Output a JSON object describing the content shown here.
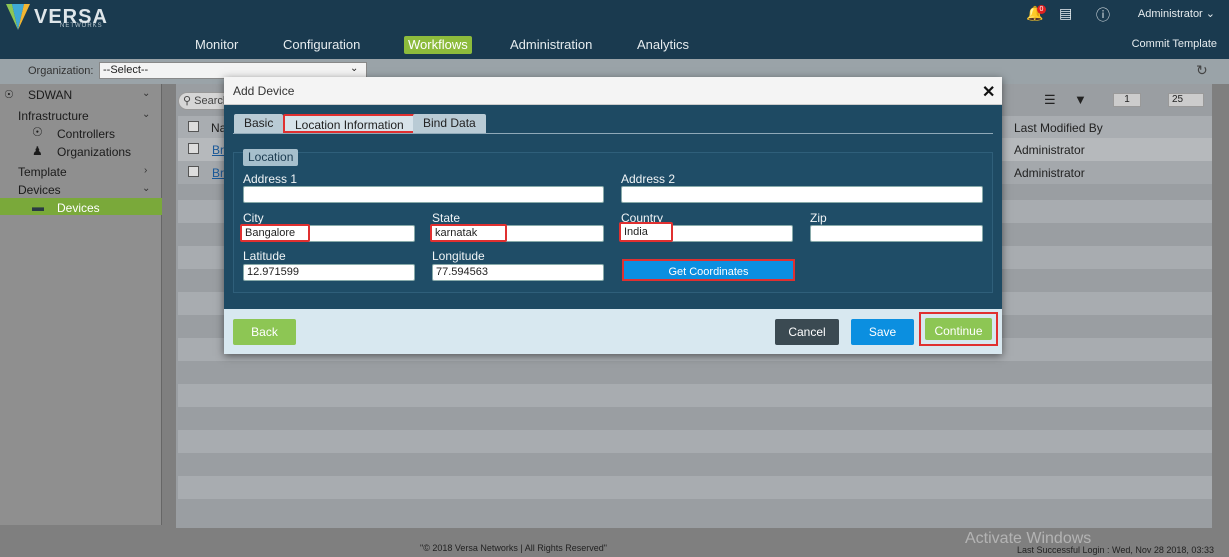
{
  "app": {
    "logo": "VERSA",
    "logo_sub": "NETWORKS",
    "notification_count": "0",
    "user": "Administrator",
    "commit": "Commit Template"
  },
  "nav": [
    "Monitor",
    "Configuration",
    "Workflows",
    "Administration",
    "Analytics"
  ],
  "org": {
    "label": "Organization:",
    "value": "--Select--"
  },
  "sidebar": {
    "sdwan": "SDWAN",
    "infrastructure": "Infrastructure",
    "controllers": "Controllers",
    "organizations": "Organizations",
    "template": "Template",
    "devices": "Devices",
    "devices_item": "Devices"
  },
  "grid": {
    "search_placeholder": "Search",
    "col_name": "Na",
    "col_last_modified": "Last Modified By",
    "rows": [
      {
        "name": "Br",
        "last_modified_by": "Administrator"
      },
      {
        "name": "Br",
        "last_modified_by": "Administrator"
      }
    ],
    "page": "1",
    "page_size": "25"
  },
  "dialog": {
    "title": "Add Device",
    "tabs": [
      "Basic",
      "Location Information",
      "Bind Data"
    ],
    "section": "Location",
    "fields": {
      "address1": {
        "label": "Address 1",
        "value": ""
      },
      "address2": {
        "label": "Address 2",
        "value": ""
      },
      "city": {
        "label": "City",
        "value": "Bangalore"
      },
      "state": {
        "label": "State",
        "value": "karnatak"
      },
      "country": {
        "label": "Country",
        "value": "India"
      },
      "zip": {
        "label": "Zip",
        "value": ""
      },
      "latitude": {
        "label": "Latitude",
        "value": "12.971599"
      },
      "longitude": {
        "label": "Longitude",
        "value": "77.594563"
      }
    },
    "get_coordinates": "Get Coordinates",
    "buttons": {
      "back": "Back",
      "cancel": "Cancel",
      "save": "Save",
      "continue": "Continue"
    }
  },
  "footer": {
    "copyright": "\"© 2018 Versa Networks | All Rights Reserved\"",
    "last_login": "Last Successful Login : Wed, Nov 28 2018, 03:33",
    "watermark": "Activate Windows"
  },
  "colors": {
    "header": "#1a3a4f",
    "accent_green": "#8dc654",
    "primary_blue": "#0b8fe0",
    "highlight_red": "#e03030"
  }
}
